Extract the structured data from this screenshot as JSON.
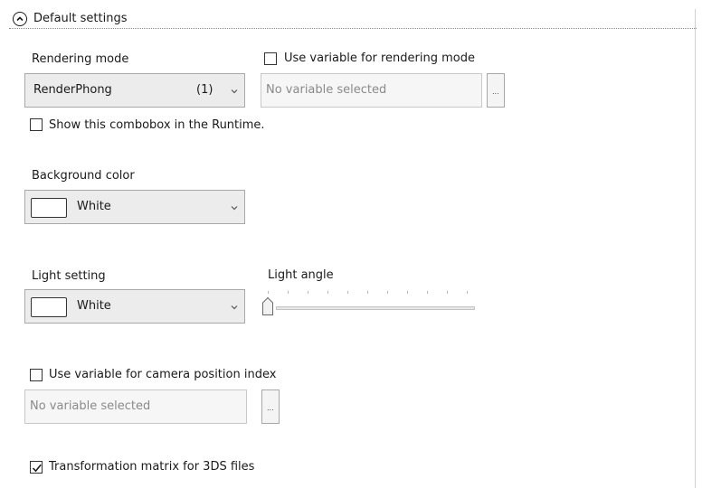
{
  "section": {
    "title": "Default settings"
  },
  "rendering": {
    "label": "Rendering mode",
    "combo_value": "RenderPhong",
    "combo_index": "(1)",
    "use_variable_label": "Use variable for rendering mode",
    "use_variable_checked": false,
    "variable_placeholder": "No variable selected",
    "browse_label": "...",
    "show_in_runtime_label": "Show this combobox in the Runtime.",
    "show_in_runtime_checked": false
  },
  "background": {
    "label": "Background color",
    "color_name": "White",
    "color": "#ffffff"
  },
  "light": {
    "label": "Light setting",
    "color_name": "White",
    "color": "#ffffff",
    "angle_label": "Light angle",
    "angle_value": 0
  },
  "camera": {
    "use_variable_label": "Use variable for camera position index",
    "use_variable_checked": false,
    "variable_placeholder": "No variable selected",
    "browse_label": "..."
  },
  "transformation": {
    "label": "Transformation matrix for 3DS files",
    "checked": true
  }
}
